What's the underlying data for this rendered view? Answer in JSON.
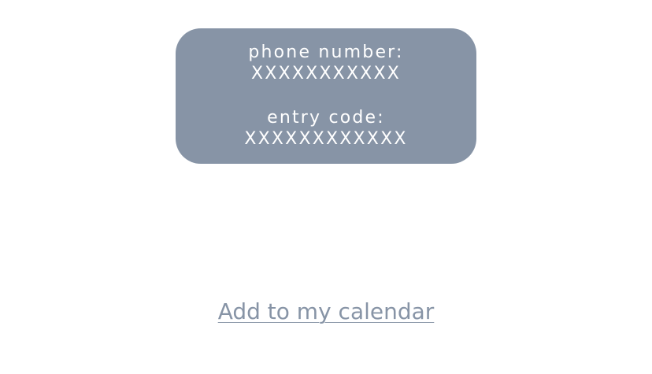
{
  "dial_in": {
    "phone_label": "phone number:",
    "phone_value": "XXXXXXXXXXX",
    "code_label": "entry code:",
    "code_value": "XXXXXXXXXXXX"
  },
  "actions": {
    "calendar_link": "Add to my calendar"
  }
}
